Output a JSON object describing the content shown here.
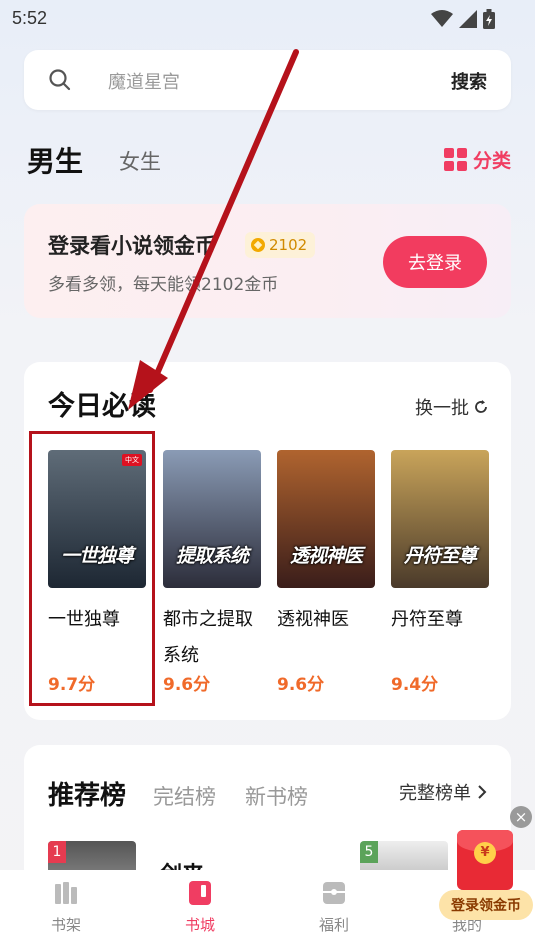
{
  "status_bar": {
    "time": "5:52"
  },
  "search": {
    "placeholder": "魔道星宫",
    "button_label": "搜索"
  },
  "gender_tabs": {
    "male": "男生",
    "female": "女生",
    "category_label": "分类"
  },
  "login_banner": {
    "title": "登录看小说领金币",
    "coin_amount": "2102",
    "subtitle": "多看多领，每天能领2102金币",
    "button_label": "去登录"
  },
  "daily_read": {
    "title": "今日必读",
    "refresh_label": "换一批",
    "books": [
      {
        "title": "一世独尊",
        "score": "9.7分",
        "cover_text": "一世独尊",
        "cover_color_top": "#5f6c78",
        "cover_color_bottom": "#1d2733"
      },
      {
        "title": "都市之提取系统",
        "score": "9.6分",
        "cover_text": "提取系统",
        "cover_color_top": "#8a9bb5",
        "cover_color_bottom": "#2c2d3a"
      },
      {
        "title": "透视神医",
        "score": "9.6分",
        "cover_text": "透视神医",
        "cover_color_top": "#b0642f",
        "cover_color_bottom": "#3a1d1a"
      },
      {
        "title": "丹符至尊",
        "score": "9.4分",
        "cover_text": "丹符至尊",
        "cover_color_top": "#c9a45a",
        "cover_color_bottom": "#4a3a2a"
      }
    ]
  },
  "ranking": {
    "active_tab": "推荐榜",
    "tabs": [
      "完结榜",
      "新书榜"
    ],
    "full_list_label": "完整榜单",
    "first_item": {
      "rank": "1",
      "title": "剑来"
    },
    "second_item": {
      "rank": "5"
    }
  },
  "bottom_nav": [
    {
      "label": "书架",
      "icon": "bookshelf-icon"
    },
    {
      "label": "书城",
      "icon": "bookstore-icon"
    },
    {
      "label": "福利",
      "icon": "gift-icon"
    },
    {
      "label": "我的",
      "icon": "profile-icon"
    }
  ],
  "redpacket": {
    "label": "登录领金币",
    "symbol": "¥",
    "close": "×"
  },
  "colors": {
    "accent": "#f03d62",
    "score": "#f06a2a",
    "annotation": "#b5121b"
  }
}
